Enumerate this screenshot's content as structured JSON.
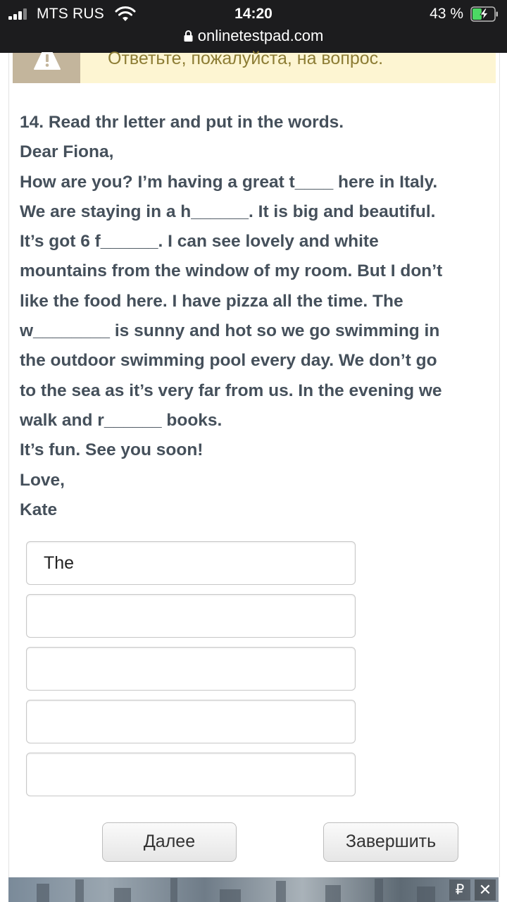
{
  "status_bar": {
    "carrier": "MTS RUS",
    "time": "14:20",
    "battery_percent": "43 %",
    "battery_level": 0.43
  },
  "browser": {
    "url": "onlinetestpad.com"
  },
  "notice": {
    "text": "Ответьте, пожалуйста, на вопрос.",
    "icon": "warning-icon"
  },
  "question": {
    "lines": [
      "14. Read thr letter and put in the words.",
      "Dear Fiona,",
      "How are you? I’m having a great t____ here in Italy.",
      "We are staying in a h______. It is big and beautiful.",
      "It’s got 6 f______. I can see lovely and white",
      "mountains from the window of my room. But I don’t",
      "like the food here. I have pizza all the time. The",
      "w________ is sunny and hot so we go swimming in",
      "the outdoor swimming pool every day. We don’t go",
      "to the sea as  it’s very far from us. In the evening we",
      "walk and r______ books.",
      "It’s fun. See you soon!",
      "Love,",
      "Kate"
    ]
  },
  "answers": [
    {
      "value": "The"
    },
    {
      "value": ""
    },
    {
      "value": ""
    },
    {
      "value": ""
    },
    {
      "value": ""
    }
  ],
  "buttons": {
    "next_label": "Далее",
    "finish_label": "Завершить"
  },
  "ad": {
    "ruble_label": "₽",
    "close_label": "✕"
  },
  "colors": {
    "notice_bg": "#fdf5d2",
    "notice_text": "#8d7d35",
    "question_text": "#45505b",
    "battery_green": "#4cd964"
  }
}
